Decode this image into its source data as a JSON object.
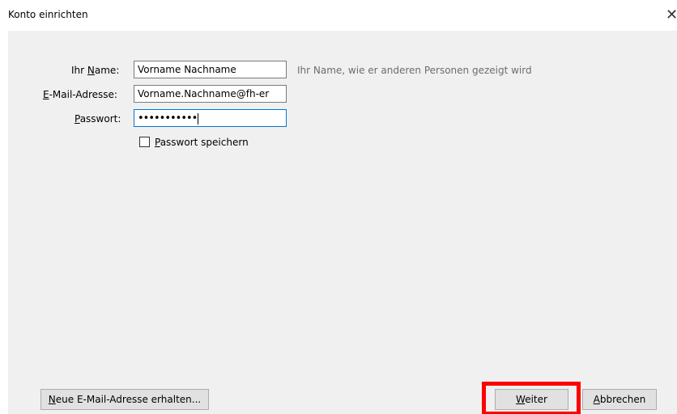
{
  "window": {
    "title": "Konto einrichten",
    "close_glyph": "✕"
  },
  "form": {
    "name": {
      "label_pre": "Ihr ",
      "label_ak": "N",
      "label_post": "ame:",
      "value": "Vorname Nachname",
      "hint": "Ihr Name, wie er anderen Personen gezeigt wird"
    },
    "email": {
      "label_pre": "",
      "label_ak": "E",
      "label_post": "-Mail-Adresse:",
      "value": "Vorname.Nachname@fh-er"
    },
    "password": {
      "label_pre": "",
      "label_ak": "P",
      "label_post": "asswort:",
      "value": "•••••••••••"
    },
    "remember_password": {
      "label_ak": "P",
      "label_post": "asswort speichern",
      "checked": false
    }
  },
  "footer": {
    "new_address_button": {
      "label_ak": "N",
      "label_post": "eue E-Mail-Adresse erhalten..."
    },
    "next_button": {
      "label_ak": "W",
      "label_post": "eiter"
    },
    "cancel_button": {
      "label_ak": "A",
      "label_post": "bbrechen"
    }
  },
  "colors": {
    "dialog_bg": "#f0f0f0",
    "focus_border": "#0078d7",
    "highlight": "#ff0000",
    "hint_text": "#6d6d6d"
  },
  "icons": {
    "close": "close-icon"
  }
}
